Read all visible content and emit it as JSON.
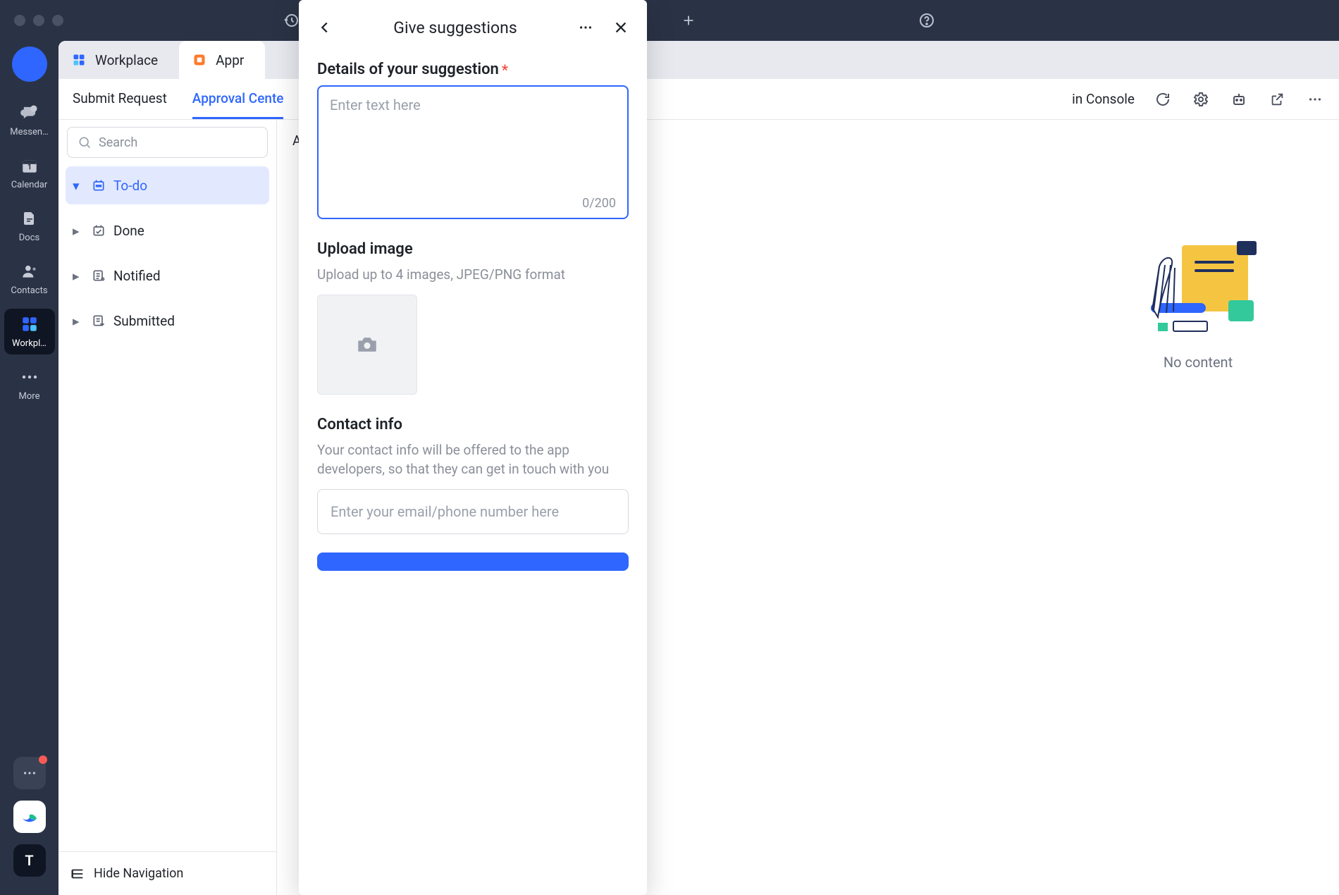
{
  "titlebar": {},
  "rail": {
    "items": [
      {
        "label": "Messen…"
      },
      {
        "label": "Calendar"
      },
      {
        "label": "Docs"
      },
      {
        "label": "Contacts"
      },
      {
        "label": "Workpl…"
      },
      {
        "label": "More"
      }
    ],
    "bottom_letter": "T"
  },
  "tabs": {
    "workplace": "Workplace",
    "approval": "Appr"
  },
  "subtabs": {
    "submit": "Submit Request",
    "center": "Approval Cente",
    "console": "in Console"
  },
  "sidepanel": {
    "search_placeholder": "Search",
    "items": [
      {
        "label": "To-do"
      },
      {
        "label": "Done"
      },
      {
        "label": "Notified"
      },
      {
        "label": "Submitted"
      }
    ],
    "hide_nav": "Hide Navigation"
  },
  "detail": {
    "crumb_first": "A",
    "empty": "No content"
  },
  "modal": {
    "title": "Give suggestions",
    "details_label": "Details of your suggestion",
    "details_placeholder": "Enter text here",
    "counter": "0/200",
    "upload_label": "Upload image",
    "upload_sub": "Upload up to 4 images, JPEG/PNG format",
    "contact_label": "Contact info",
    "contact_sub": "Your contact info will be offered to the app developers, so that they can get in touch with you",
    "contact_placeholder": "Enter your email/phone number here"
  }
}
